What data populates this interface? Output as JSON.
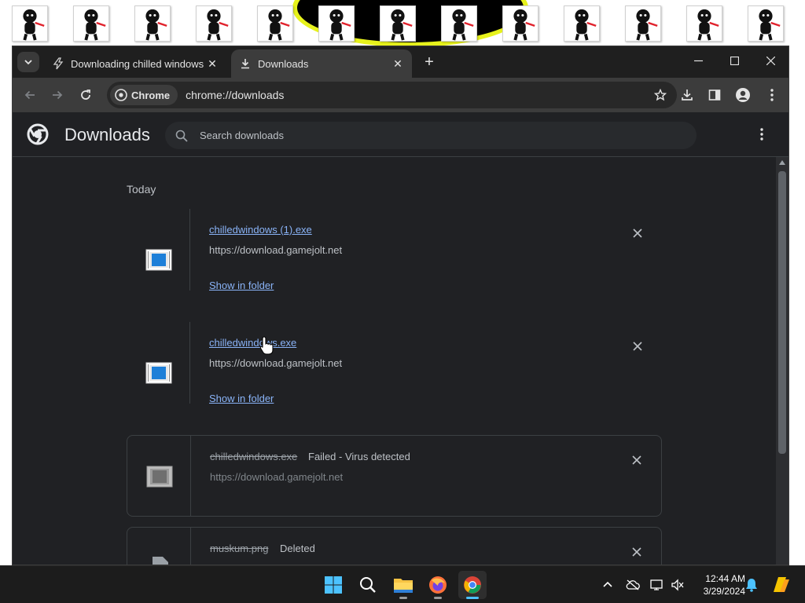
{
  "browser": {
    "tabs": [
      {
        "title": "Downloading chilled windows",
        "icon": "bolt-icon",
        "active": false
      },
      {
        "title": "Downloads",
        "icon": "download-icon",
        "active": true
      }
    ],
    "omnibox": {
      "chip": "Chrome",
      "url": "chrome://downloads"
    }
  },
  "downloads_page": {
    "title": "Downloads",
    "search_placeholder": "Search downloads",
    "day": "Today",
    "items": [
      {
        "name": "chilledwindows (1).exe",
        "source": "https://download.gamejolt.net",
        "status": "",
        "action": "Show in folder",
        "state": "complete"
      },
      {
        "name": "chilledwindows.exe",
        "source": "https://download.gamejolt.net",
        "status": "",
        "action": "Show in folder",
        "state": "complete"
      },
      {
        "name": "chilledwindows.exe",
        "source": "https://download.gamejolt.net",
        "status": "Failed - Virus detected",
        "action": "",
        "state": "failed"
      },
      {
        "name": "muskum.png",
        "source": "",
        "status": "Deleted",
        "action": "",
        "state": "deleted"
      }
    ]
  },
  "taskbar": {
    "apps": [
      "windows-start-icon",
      "search-icon",
      "file-explorer-icon",
      "firefox-icon",
      "chrome-icon"
    ],
    "time": "12:44 AM",
    "date": "3/29/2024"
  },
  "colors": {
    "accent": "#8ab4f8",
    "page_bg": "#202124",
    "taskbar_bg": "#1c1c1c"
  }
}
